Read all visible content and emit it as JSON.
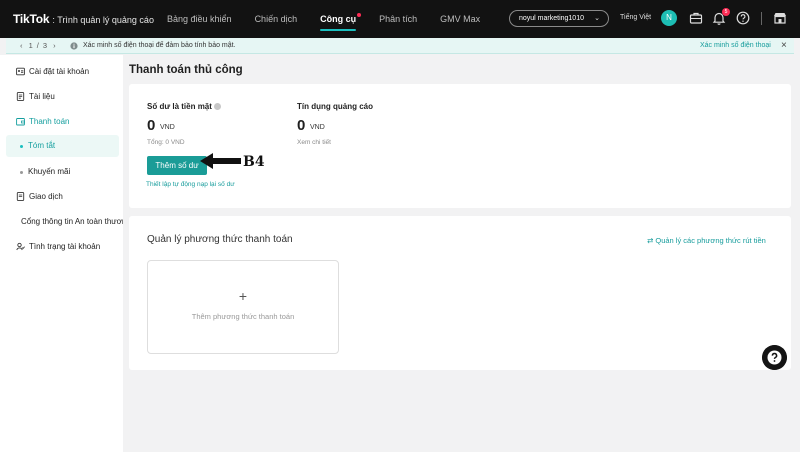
{
  "header": {
    "brand_logo": "TikTok",
    "brand_sub": ": Trình quản lý quảng cáo",
    "nav": [
      {
        "label": "Bảng điều khiển",
        "active": false
      },
      {
        "label": "Chiến dịch",
        "active": false
      },
      {
        "label": "Công cụ",
        "active": true
      },
      {
        "label": "Phân tích",
        "active": false
      },
      {
        "label": "GMV Max",
        "active": false
      }
    ],
    "account": "noyul marketing1010",
    "language": "Tiếng Việt",
    "avatar_initial": "N",
    "notification_count": "5",
    "icons": [
      "briefcase-icon",
      "bell-icon",
      "help-icon",
      "store-icon"
    ]
  },
  "notice": {
    "pager": {
      "current": "1",
      "sep": "/",
      "total": "3"
    },
    "text": "Xác minh số điện thoại để đảm bảo tính bảo mật.",
    "link": "Xác minh số điện thoại"
  },
  "sidebar": {
    "items": [
      {
        "label": "Cài đặt tài khoản",
        "icon": "account-settings-icon"
      },
      {
        "label": "Tài liệu",
        "icon": "document-icon"
      },
      {
        "label": "Thanh toán",
        "icon": "wallet-icon",
        "active": true
      },
      {
        "label": "Tóm tắt",
        "sub": true,
        "active": true
      },
      {
        "label": "Khuyến mãi",
        "sub": true
      },
      {
        "label": "Giao dịch",
        "icon": "transaction-icon"
      },
      {
        "label": "Cổng thông tin An toàn thương hiệu"
      },
      {
        "label": "Tình trạng tài khoản",
        "icon": "account-status-icon"
      }
    ]
  },
  "main": {
    "title": "Thanh toán thủ công",
    "cash": {
      "label": "Số dư là tiền mặt",
      "value": "0",
      "unit": "VND",
      "sub": "Tổng: 0 VND"
    },
    "credit": {
      "label": "Tín dụng quảng cáo",
      "value": "0",
      "unit": "VND",
      "sub": "Xem chi tiết"
    },
    "add_button": "Thêm số dư",
    "auto_link": "Thiết lập tự động nạp lại số dư",
    "annotation": "B4",
    "methods": {
      "title": "Quản lý phương thức thanh toán",
      "manage_link": "Quản lý các phương thức rút tiền",
      "add_plus": "+",
      "add_label": "Thêm phương thức thanh toán"
    }
  }
}
